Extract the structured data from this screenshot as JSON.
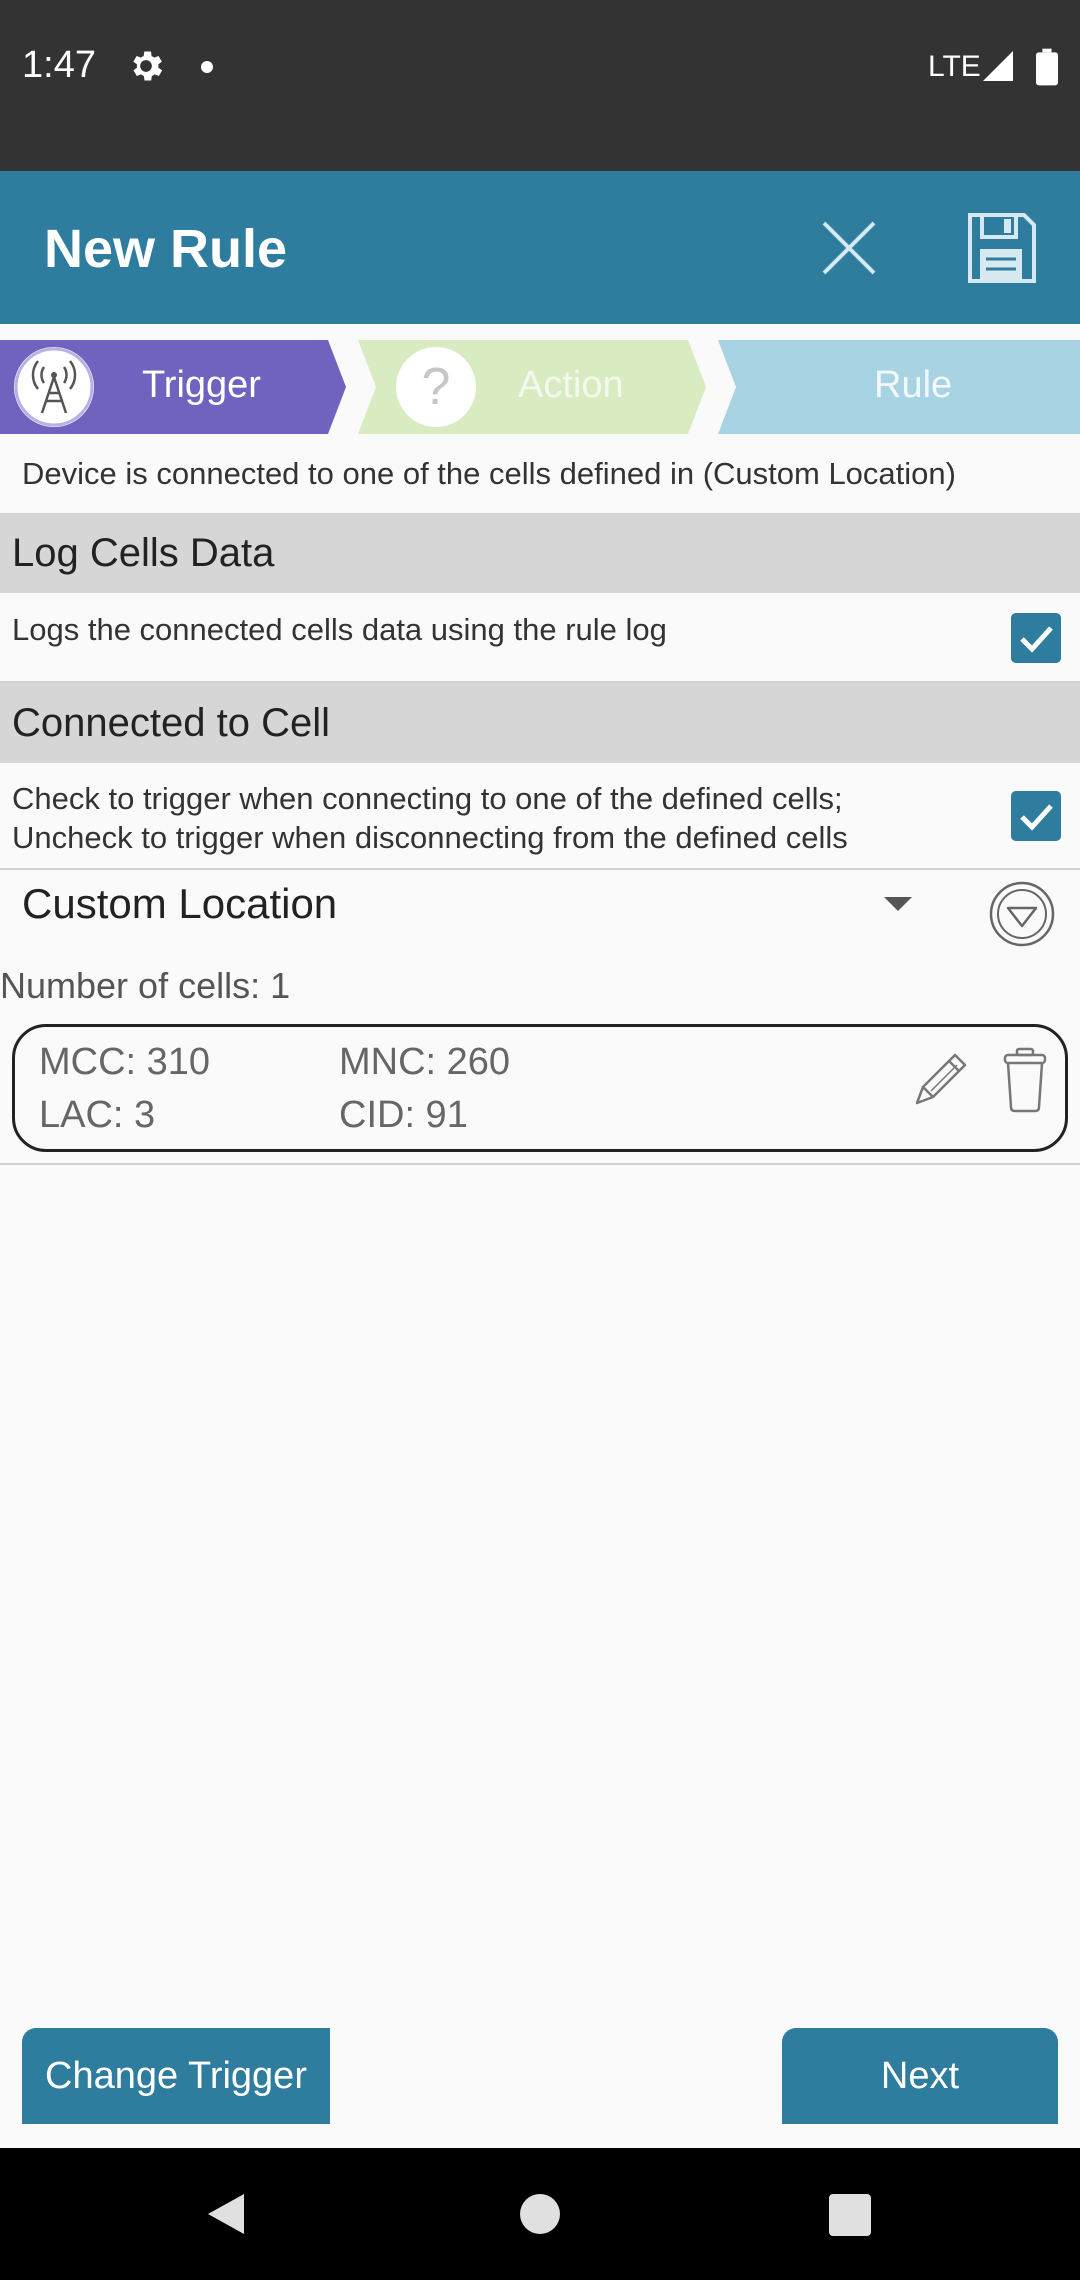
{
  "status_bar": {
    "time": "1:47",
    "network": "LTE"
  },
  "app_bar": {
    "title": "New Rule"
  },
  "steps": [
    {
      "label": "Trigger"
    },
    {
      "label": "Action",
      "icon_text": "?"
    },
    {
      "label": "Rule"
    }
  ],
  "trigger_description": "Device is connected to one of the cells defined in (Custom Location)",
  "sections": {
    "log_cells": {
      "title": "Log Cells Data",
      "description": "Logs the connected cells data using the rule log",
      "checked": true
    },
    "connected": {
      "title": "Connected to Cell",
      "description_line1": "Check to trigger when connecting to one of the defined cells;",
      "description_line2": "Uncheck to trigger when disconnecting from the defined cells",
      "checked": true
    }
  },
  "location": {
    "selected": "Custom Location"
  },
  "cells": {
    "count_label": "Number of cells: 1",
    "items": [
      {
        "mcc": "MCC: 310",
        "mnc": "MNC: 260",
        "lac": "LAC:  3",
        "cid": "CID:   91"
      }
    ]
  },
  "buttons": {
    "change_trigger": "Change Trigger",
    "next": "Next"
  },
  "colors": {
    "primary": "#2e7d9e",
    "trigger_step": "#7063bf",
    "action_step": "#d9ebc0",
    "rule_step": "#a8d3e2",
    "status_bar": "#333333"
  },
  "icons": {
    "settings": "gear-icon",
    "close": "close-icon",
    "save": "floppy-disk-icon",
    "trigger": "cell-tower-icon",
    "edit": "pencil-icon",
    "delete": "trash-icon"
  }
}
